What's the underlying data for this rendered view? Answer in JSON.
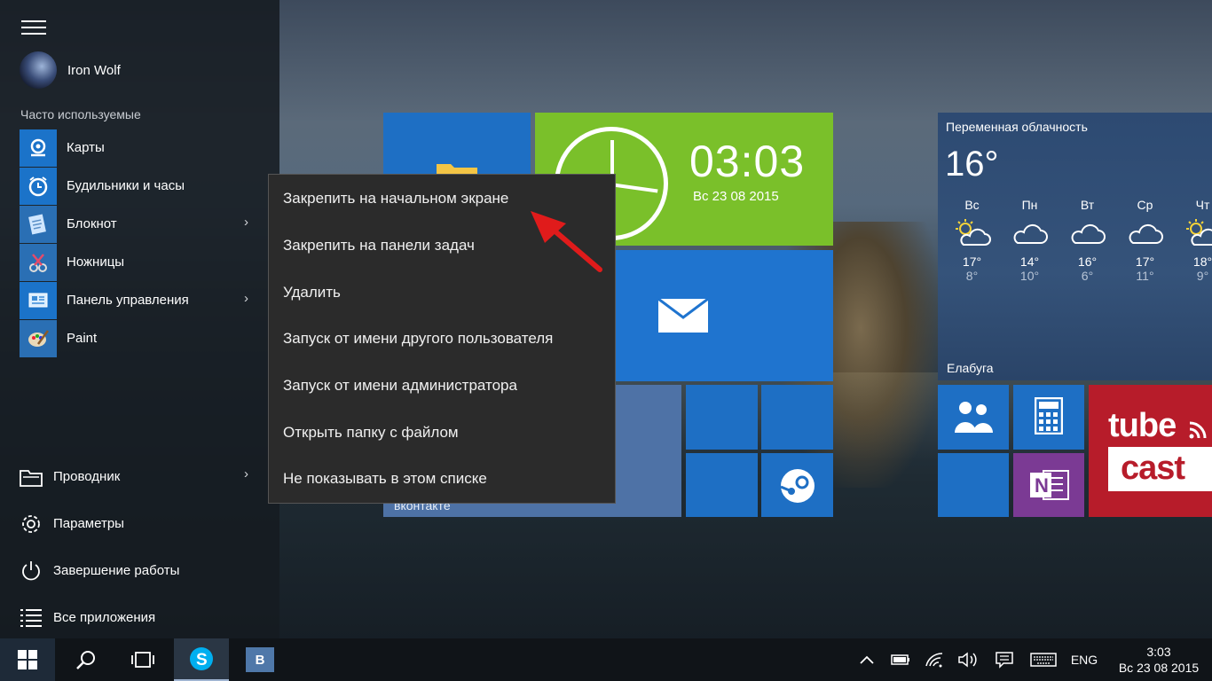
{
  "user": {
    "name": "Iron Wolf"
  },
  "start_menu": {
    "most_used_label": "Часто используемые",
    "apps": [
      {
        "label": "Карты",
        "icon": "maps-icon",
        "has_arrow": false
      },
      {
        "label": "Будильники и часы",
        "icon": "alarm-clock-icon",
        "has_arrow": false
      },
      {
        "label": "Блокнот",
        "icon": "notepad-icon",
        "has_arrow": true
      },
      {
        "label": "Ножницы",
        "icon": "snipping-tool-icon",
        "has_arrow": false
      },
      {
        "label": "Панель управления",
        "icon": "control-panel-icon",
        "has_arrow": true
      },
      {
        "label": "Paint",
        "icon": "paint-icon",
        "has_arrow": false
      }
    ],
    "bottom": [
      {
        "label": "Проводник",
        "icon": "file-explorer-icon",
        "has_arrow": true
      },
      {
        "label": "Параметры",
        "icon": "gear-icon",
        "has_arrow": false
      },
      {
        "label": "Завершение работы",
        "icon": "power-icon",
        "has_arrow": false
      },
      {
        "label": "Все приложения",
        "icon": "all-apps-icon",
        "has_arrow": false
      }
    ]
  },
  "tiles": {
    "clock": {
      "time": "03:03",
      "date": "Вс 23 08 2015"
    },
    "vk": {
      "label": "вконтакте"
    },
    "weather": {
      "condition": "Переменная облачность",
      "temp": "16°",
      "city": "Елабуга",
      "days": [
        {
          "name": "Вс",
          "hi": "17°",
          "lo": "8°",
          "icon": "partly-sunny-icon"
        },
        {
          "name": "Пн",
          "hi": "14°",
          "lo": "10°",
          "icon": "cloud-icon"
        },
        {
          "name": "Вт",
          "hi": "16°",
          "lo": "6°",
          "icon": "cloud-icon"
        },
        {
          "name": "Ср",
          "hi": "17°",
          "lo": "11°",
          "icon": "cloud-icon"
        },
        {
          "name": "Чт",
          "hi": "18°",
          "lo": "9°",
          "icon": "partly-sunny-icon"
        }
      ]
    },
    "tubecast": {
      "line1": "tube",
      "line2": "cast"
    }
  },
  "context_menu": {
    "items": [
      "Закрепить на начальном экране",
      "Закрепить на панели задач",
      "Удалить",
      "Запуск от имени другого пользователя",
      "Запуск от имени администратора",
      "Открыть папку с файлом",
      "Не показывать в этом списке"
    ]
  },
  "taskbar": {
    "lang": "ENG",
    "time": "3:03",
    "date": "Вс 23 08 2015",
    "vk_letter": "B"
  },
  "colors": {
    "tile_blue": "#1e6fc4",
    "tile_green": "#7ac02a",
    "tile_purple": "#7b3a94",
    "tile_red": "#b71c2a",
    "arrow_red": "#e01b1b"
  }
}
